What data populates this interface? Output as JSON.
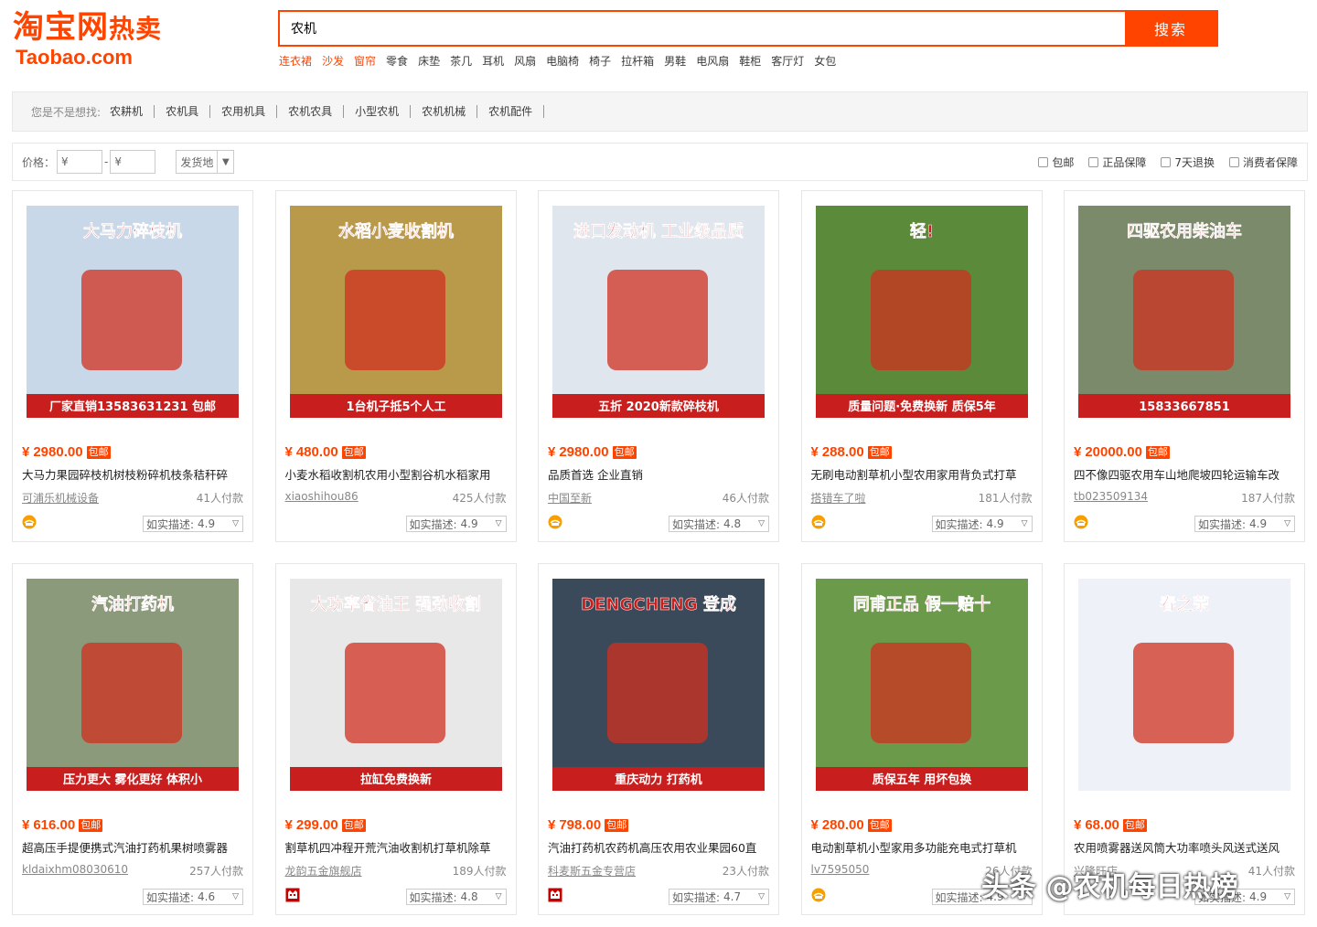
{
  "logo": {
    "main": "淘宝网",
    "hot": "热卖",
    "sub": "Taobao.com"
  },
  "search": {
    "value": "农机",
    "button": "搜索"
  },
  "hot_words": [
    {
      "text": "连衣裙",
      "red": true
    },
    {
      "text": "沙发",
      "red": true
    },
    {
      "text": "窗帘",
      "red": true
    },
    {
      "text": "零食",
      "red": false
    },
    {
      "text": "床垫",
      "red": false
    },
    {
      "text": "茶几",
      "red": false
    },
    {
      "text": "耳机",
      "red": false
    },
    {
      "text": "风扇",
      "red": false
    },
    {
      "text": "电脑椅",
      "red": false
    },
    {
      "text": "椅子",
      "red": false
    },
    {
      "text": "拉杆箱",
      "red": false
    },
    {
      "text": "男鞋",
      "red": false
    },
    {
      "text": "电风扇",
      "red": false
    },
    {
      "text": "鞋柜",
      "red": false
    },
    {
      "text": "客厅灯",
      "red": false
    },
    {
      "text": "女包",
      "red": false
    }
  ],
  "suggest": {
    "label": "您是不是想找:",
    "items": [
      "农耕机",
      "农机具",
      "农用机具",
      "农机农具",
      "小型农机",
      "农机机械",
      "农机配件"
    ]
  },
  "filter": {
    "price_label": "价格：",
    "price_placeholder": "¥",
    "dash": "-",
    "ship_label": "发货地",
    "checks": [
      "包邮",
      "正品保障",
      "7天退换",
      "消费者保障"
    ]
  },
  "currency": "¥",
  "free_tag": "包邮",
  "desc_label": "如实描述:",
  "products": [
    {
      "price": "2980.00",
      "title": "大马力果园碎枝机树枝粉碎机枝条秸秆碎",
      "seller": "可浦乐机械设备",
      "sold": "41人付款",
      "score": "4.9",
      "badge": "gold",
      "img_text": "大马力碎枝机",
      "img_sub": "厂家直销13583631231 包邮",
      "img_color": "#c8d8e8"
    },
    {
      "price": "480.00",
      "title": "小麦水稻收割机农用小型割谷机水稻家用",
      "seller": "xiaoshihou86",
      "sold": "425人付款",
      "score": "4.9",
      "badge": "none",
      "img_text": "水稻小麦收割机",
      "img_sub": "1台机子抵5个人工",
      "img_color": "#b89a4a"
    },
    {
      "price": "2980.00",
      "title": "品质首选 企业直销",
      "seller": "中国至新",
      "sold": "46人付款",
      "score": "4.8",
      "badge": "gold",
      "img_text": "进口发动机 工业级品质",
      "img_sub": "五折 2020新款碎枝机",
      "img_color": "#dfe6ee"
    },
    {
      "price": "288.00",
      "title": "无刷电动割草机小型农用家用背负式打草",
      "seller": "搭错车了啦",
      "sold": "181人付款",
      "score": "4.9",
      "badge": "gold",
      "img_text": "轻!",
      "img_sub": "质量问题·免费换新 质保5年",
      "img_color": "#5a8a3a"
    },
    {
      "price": "20000.00",
      "title": "四不像四驱农用车山地爬坡四轮运输车改",
      "seller": "tb023509134",
      "sold": "187人付款",
      "score": "4.9",
      "badge": "gold",
      "img_text": "四驱农用柴油车",
      "img_sub": "15833667851",
      "img_color": "#7a8a6a"
    },
    {
      "price": "616.00",
      "title": "超高压手提便携式汽油打药机果树喷雾器",
      "seller": "kldaixhm08030610",
      "sold": "257人付款",
      "score": "4.6",
      "badge": "none",
      "img_text": "汽油打药机",
      "img_sub": "压力更大 雾化更好 体积小",
      "img_color": "#8a9a7a"
    },
    {
      "price": "299.00",
      "title": "割草机四冲程开荒汽油收割机打草机除草",
      "seller": "龙韵五金旗舰店",
      "sold": "189人付款",
      "score": "4.8",
      "badge": "red",
      "img_text": "大功率省油王 强劲收割",
      "img_sub": "拉缸免费换新",
      "img_color": "#e8e8e8"
    },
    {
      "price": "798.00",
      "title": "汽油打药机农药机高压农用农业果园60直",
      "seller": "科麦斯五金专营店",
      "sold": "23人付款",
      "score": "4.7",
      "badge": "red",
      "img_text": "DENGCHENG 登成",
      "img_sub": "重庆动力 打药机",
      "img_color": "#3a4a5a"
    },
    {
      "price": "280.00",
      "title": "电动割草机小型家用多功能充电式打草机",
      "seller": "lv7595050",
      "sold": "26人付款",
      "score": "4.9",
      "badge": "gold",
      "img_text": "同甫正品 假一赔十",
      "img_sub": "质保五年 用坏包换",
      "img_color": "#6a9a4a"
    },
    {
      "price": "68.00",
      "title": "农用喷雾器送风筒大功率喷头风送式送风",
      "seller": "兴隆旺店",
      "sold": "41人付款",
      "score": "4.9",
      "badge": "none",
      "img_text": "春之荣",
      "img_sub": "",
      "img_color": "#eef2f8"
    }
  ],
  "watermark": "头条 @农机每日热榜"
}
